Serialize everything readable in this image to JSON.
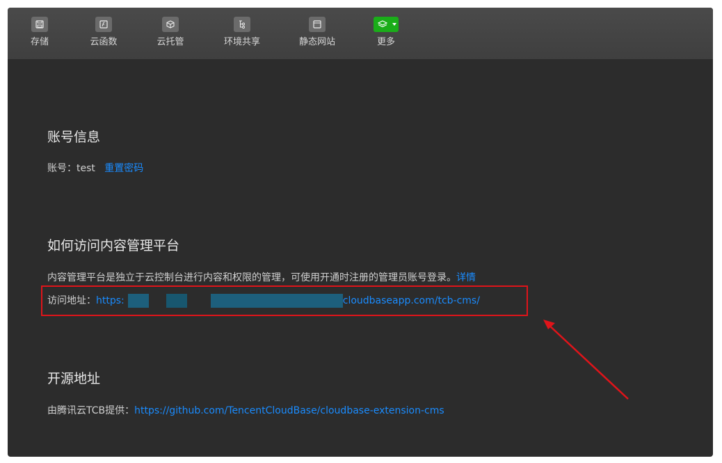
{
  "toolbar": {
    "items": [
      {
        "label": "存储",
        "icon": "storage-icon"
      },
      {
        "label": "云函数",
        "icon": "function-icon"
      },
      {
        "label": "云托管",
        "icon": "cube-icon"
      },
      {
        "label": "环境共享",
        "icon": "share-tree-icon"
      },
      {
        "label": "静态网站",
        "icon": "browser-window-icon"
      },
      {
        "label": "更多",
        "icon": "layers-icon"
      }
    ]
  },
  "account": {
    "title": "账号信息",
    "label": "账号：",
    "username": "test",
    "reset_link": "重置密码"
  },
  "access": {
    "title": "如何访问内容管理平台",
    "description": "内容管理平台是独立于云控制台进行内容和权限的管理，可使用开通时注册的管理员账号登录。",
    "details_link": "详情",
    "address_label": "访问地址：",
    "url_prefix": "https:",
    "url_suffix": "cloudbaseapp.com/tcb-cms/"
  },
  "opensource": {
    "title": "开源地址",
    "label": "由腾讯云TCB提供：",
    "url": "https://github.com/TencentCloudBase/cloudbase-extension-cms"
  },
  "colors": {
    "link": "#1a8cff",
    "annotation": "#e0141a",
    "more_button": "#1aad19"
  }
}
